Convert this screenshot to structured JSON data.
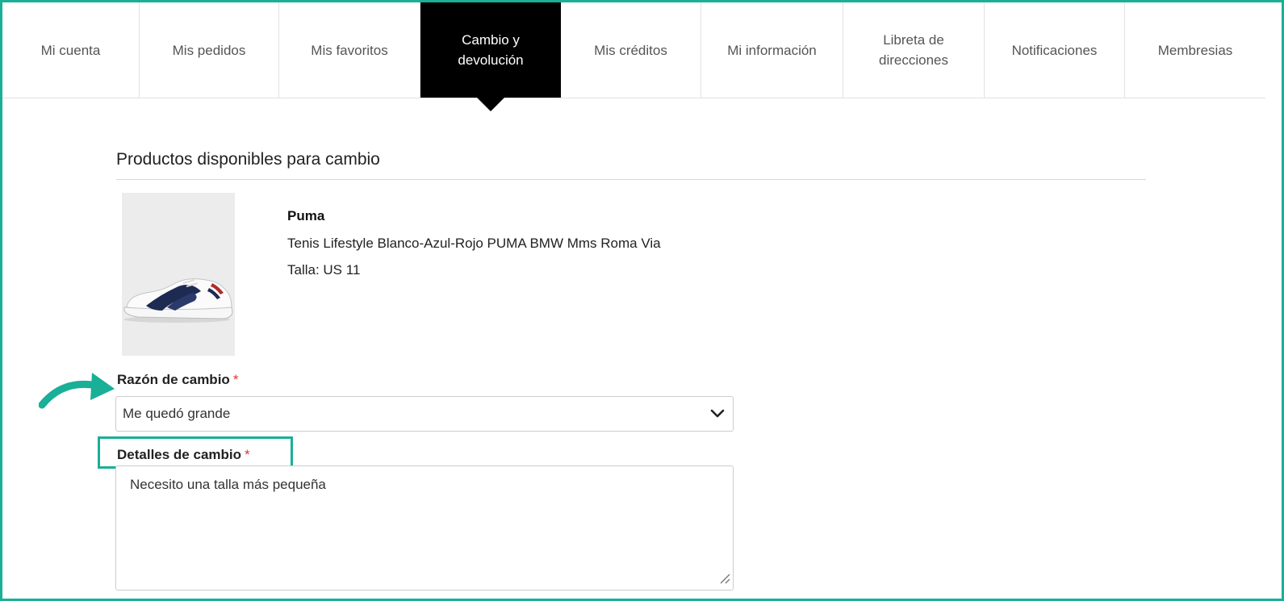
{
  "tabs": [
    {
      "label": "Mi cuenta",
      "active": false
    },
    {
      "label": "Mis pedidos",
      "active": false
    },
    {
      "label": "Mis favoritos",
      "active": false
    },
    {
      "label": "Cambio y\ndevolución",
      "active": true
    },
    {
      "label": "Mis créditos",
      "active": false
    },
    {
      "label": "Mi información",
      "active": false
    },
    {
      "label": "Libreta de\ndirecciones",
      "active": false
    },
    {
      "label": "Notificaciones",
      "active": false
    },
    {
      "label": "Membresias",
      "active": false
    }
  ],
  "section": {
    "title": "Productos disponibles para cambio"
  },
  "product": {
    "brand": "Puma",
    "name": "Tenis Lifestyle Blanco-Azul-Rojo PUMA BMW Mms Roma Via",
    "size": "Talla: US 11"
  },
  "form": {
    "reason_label": "Razón de cambio",
    "reason_value": "Me quedó grande",
    "details_label": "Detalles de cambio",
    "details_value": "Necesito una talla más pequeña",
    "required_mark": "*"
  },
  "icons": {
    "select_chevron": "chevron-down-icon",
    "resize": "resize-handle-icon",
    "pointer_arrow": "curved-arrow-icon"
  },
  "colors": {
    "accent": "#1aaf97",
    "active_tab_bg": "#000000",
    "required": "#e0342e"
  }
}
